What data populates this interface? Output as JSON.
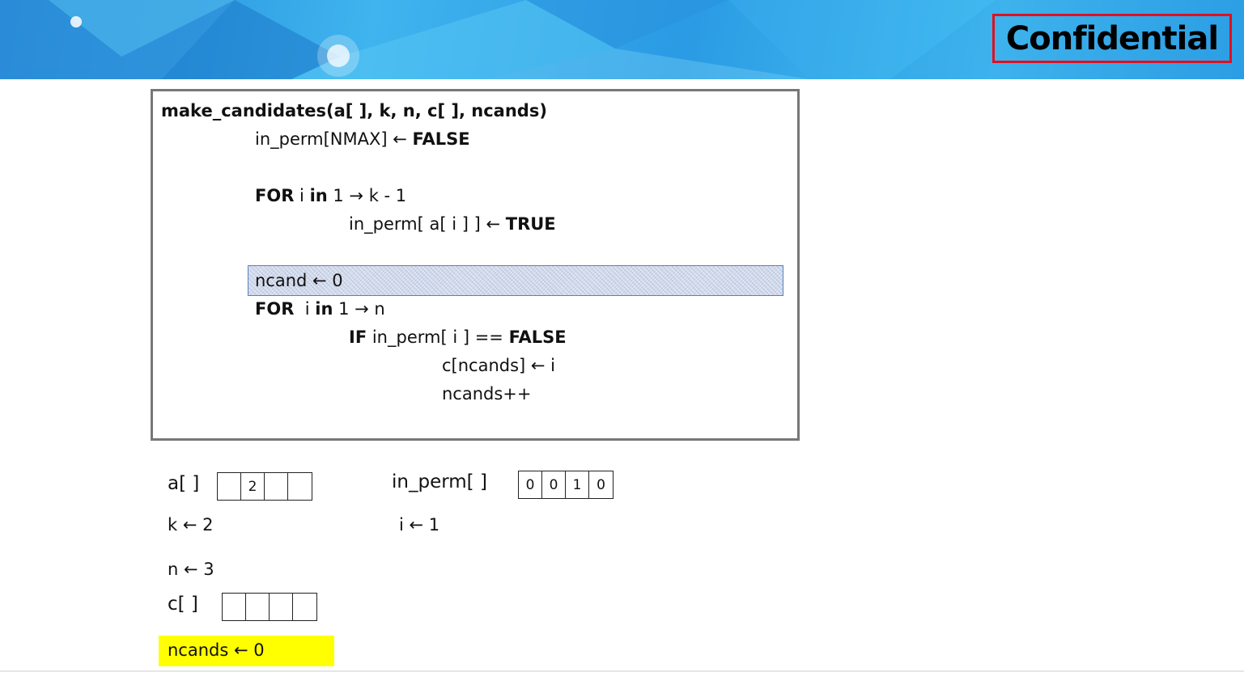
{
  "header": {
    "confidential_label": "Confidential"
  },
  "code": {
    "signature": "make_candidates(a[ ], k, n, c[ ], ncands)",
    "line1_pre": "in_perm[NMAX] ← ",
    "line1_kw": "FALSE",
    "line2_kw1": "FOR",
    "line2_mid": " i ",
    "line2_kw2": "in",
    "line2_post": " 1 → k - 1",
    "line3_pre": "in_perm[ a[ i ] ] ← ",
    "line3_kw": "TRUE",
    "line4": "ncand ← 0",
    "line5_kw1": "FOR",
    "line5_mid": "  i ",
    "line5_kw2": "in",
    "line5_post": " 1 → n",
    "line6_kw1": "IF",
    "line6_mid": " in_perm[ i ] == ",
    "line6_kw2": "FALSE",
    "line7": "c[ncands] ← i",
    "line8": "ncands++"
  },
  "vars": {
    "a_label": "a[ ]",
    "a_cells": [
      "",
      "2",
      "",
      ""
    ],
    "k_text": "k ← 2",
    "n_text": "n ← 3",
    "c_label": "c[ ]",
    "c_cells": [
      "",
      "",
      "",
      ""
    ],
    "ncands_text": "ncands ← 0",
    "in_perm_label": "in_perm[ ]",
    "in_perm_cells": [
      "0",
      "0",
      "1",
      "0"
    ],
    "i_text": "i ← 1"
  },
  "colors": {
    "highlight_yellow": "#ffff00",
    "confidential_border": "#e0101f",
    "row_highlight": "#cfd8ea"
  }
}
